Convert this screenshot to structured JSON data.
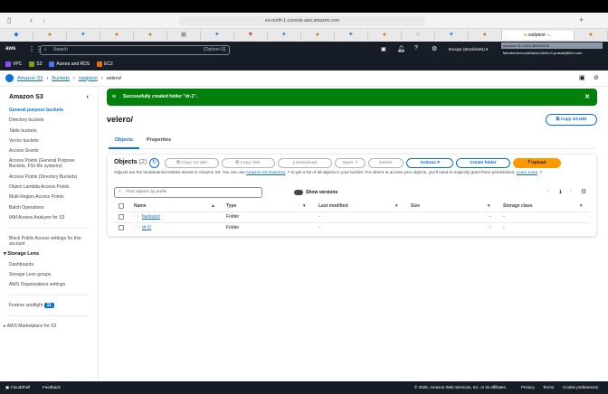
{
  "browser": {
    "url": "eu-north-1.console.aws.amazon.com",
    "active_tab": "oadptest -..."
  },
  "nav": {
    "search_placeholder": "Search",
    "search_shortcut": "[Option+S]",
    "region": "Europe (Stockholm)",
    "account_id": "Account ID: 0104-3849-8476",
    "user": "MemberAccountAdmin/Ukthi.G.prasad@ibm.com"
  },
  "favorites": [
    {
      "label": "VPC",
      "color": "#8c4fff"
    },
    {
      "label": "S3",
      "color": "#7aa116"
    },
    {
      "label": "Aurora and RDS",
      "color": "#4d72f3"
    },
    {
      "label": "EC2",
      "color": "#ed7100"
    }
  ],
  "breadcrumb": [
    "Amazon S3",
    "Buckets",
    "oadptest",
    "velero/"
  ],
  "sidebar": {
    "title": "Amazon S3",
    "items": [
      "General purpose buckets",
      "Directory buckets",
      "Table buckets",
      "Vector buckets",
      "Access Grants",
      "Access Points (General Purpose Buckets, FSx file systems)",
      "Access Points (Directory Buckets)",
      "Object Lambda Access Points",
      "Multi-Region Access Points",
      "Batch Operations",
      "IAM Access Analyzer for S3"
    ],
    "block_public": "Block Public Access settings for this account",
    "storage_lens": "Storage Lens",
    "lens_items": [
      "Dashboards",
      "Storage Lens groups",
      "AWS Organizations settings"
    ],
    "feature_spotlight": "Feature spotlight",
    "spotlight_count": "11",
    "marketplace": "AWS Marketplace for S3"
  },
  "flash": {
    "message": "Successfully created folder \"dr-1\"."
  },
  "page": {
    "title": "velero/",
    "copy_uri": "Copy S3 URI",
    "tabs": [
      "Objects",
      "Properties"
    ]
  },
  "objects": {
    "title": "Objects",
    "count": "(2)",
    "buttons": {
      "copy_uri": "Copy S3 URI",
      "copy_url": "Copy URL",
      "download": "Download",
      "open": "Open",
      "delete": "Delete",
      "actions": "Actions",
      "create_folder": "Create folder",
      "upload": "Upload"
    },
    "desc1": "Objects are the fundamental entities stored in Amazon S3. You can use",
    "inventory": "Amazon S3 inventory",
    "desc2": "to get a list of all objects in your bucket. For others to access your objects, you'll need to explicitly grant them permissions.",
    "learn_more": "Learn more",
    "search_placeholder": "Find objects by prefix",
    "show_versions": "Show versions",
    "page": "1",
    "columns": [
      "Name",
      "Type",
      "Last modified",
      "Size",
      "Storage class"
    ],
    "rows": [
      {
        "name": "backups/",
        "type": "Folder",
        "modified": "-",
        "size": "-",
        "class": "-"
      },
      {
        "name": "dr-1/",
        "type": "Folder",
        "modified": "-",
        "size": "-",
        "class": "-"
      }
    ]
  },
  "footer": {
    "cloudshell": "CloudShell",
    "feedback": "Feedback",
    "copyright": "© 2025, Amazon Web Services, Inc. or its affiliates.",
    "privacy": "Privacy",
    "terms": "Terms",
    "cookies": "Cookie preferences"
  }
}
